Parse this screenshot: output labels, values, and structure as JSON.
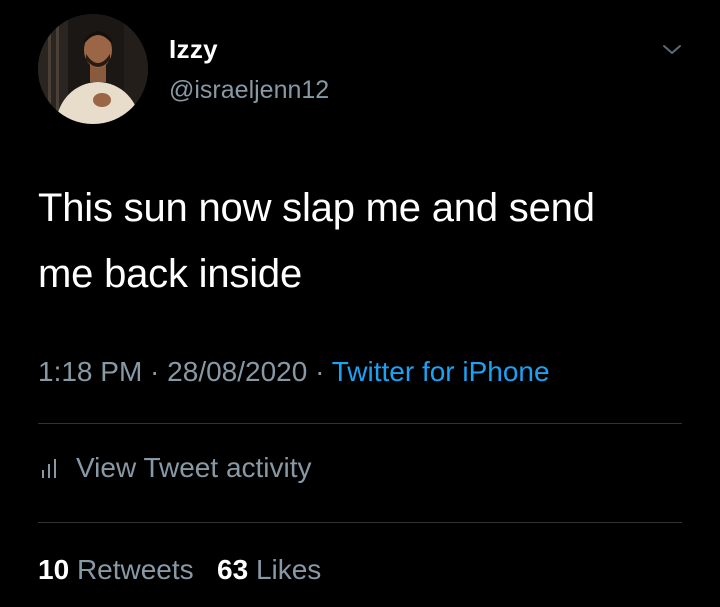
{
  "user": {
    "name": "Izzy",
    "handle": "@israeljenn12"
  },
  "tweet": {
    "text_line1": "This sun now slap me and send",
    "text_line2": "me back inside"
  },
  "meta": {
    "time": "1:18 PM",
    "separator": " · ",
    "date": "28/08/2020",
    "source": "Twitter for iPhone"
  },
  "activity": {
    "label": "View Tweet activity",
    "icon": "bar-chart-icon"
  },
  "stats": {
    "retweets_count": "10",
    "retweets_label": "Retweets",
    "likes_count": "63",
    "likes_label": "Likes"
  },
  "colors": {
    "background": "#000000",
    "text": "#ffffff",
    "secondary": "#8899a6",
    "link": "#1da1f2",
    "divider": "#2f3336"
  }
}
